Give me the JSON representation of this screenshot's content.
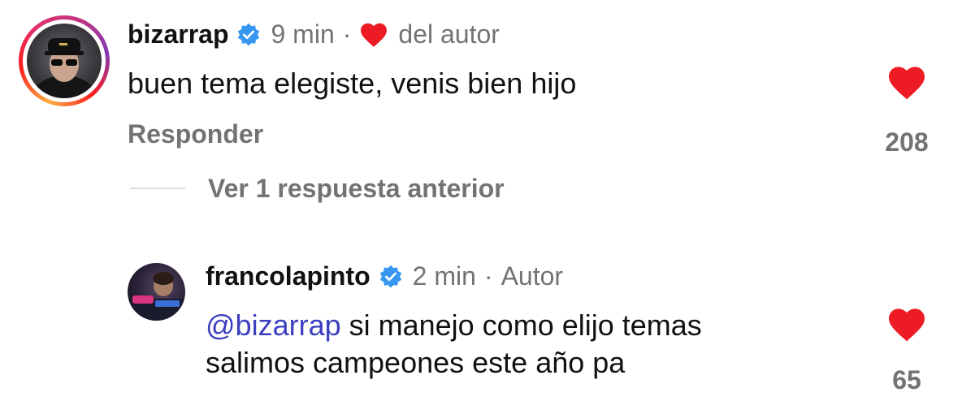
{
  "comments": [
    {
      "username": "bizarrap",
      "time": "9 min",
      "separator": "·",
      "author_liked_label": "del autor",
      "text": "buen tema elegiste, venis bien hijo",
      "reply_label": "Responder",
      "like_count": "208",
      "liked": true
    },
    {
      "username": "francolapinto",
      "time": "2 min",
      "separator": "·",
      "author_label": "Autor",
      "mention": "@bizarrap",
      "text_line1": " si manejo como elijo temas",
      "text_line2": "salimos campeones este año pa",
      "like_count": "65",
      "liked": true
    }
  ],
  "view_previous_replies": "Ver 1 respuesta anterior",
  "colors": {
    "like_red": "#ed1c24",
    "verified_blue": "#3797f0",
    "mention": "#3b3fbf",
    "muted": "#737373"
  },
  "icons": [
    "verified-badge-icon",
    "heart-icon"
  ]
}
